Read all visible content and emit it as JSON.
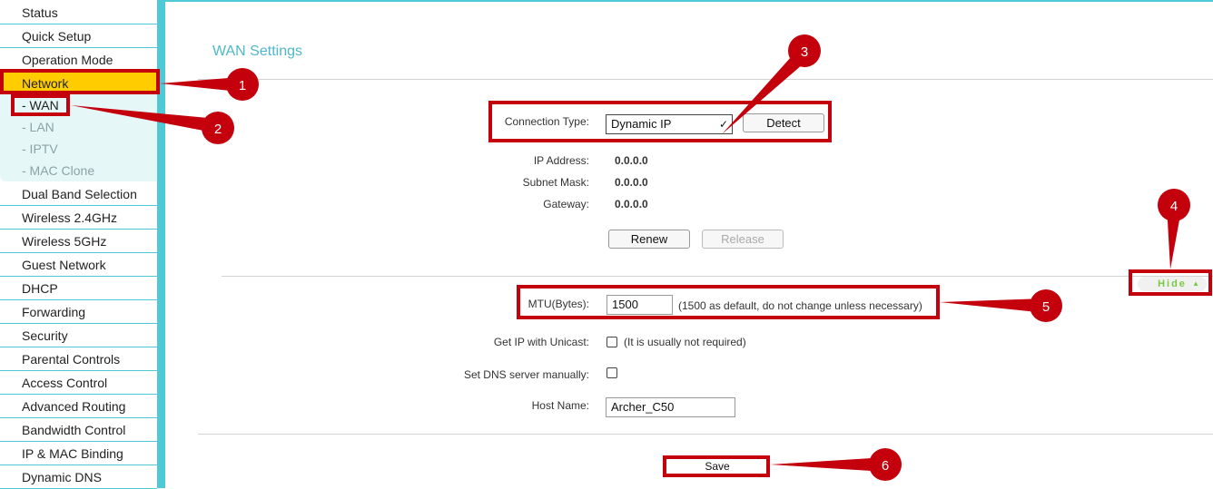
{
  "sidebar": {
    "items_top": [
      "Status",
      "Quick Setup",
      "Operation Mode",
      "Network"
    ],
    "submenu": [
      "- WAN",
      "- LAN",
      "- IPTV",
      "- MAC Clone"
    ],
    "items_bottom": [
      "Dual Band Selection",
      "Wireless 2.4GHz",
      "Wireless 5GHz",
      "Guest Network",
      "DHCP",
      "Forwarding",
      "Security",
      "Parental Controls",
      "Access Control",
      "Advanced Routing",
      "Bandwidth Control",
      "IP & MAC Binding",
      "Dynamic DNS"
    ]
  },
  "main": {
    "title": "WAN Settings",
    "connection_type_label": "Connection Type:",
    "connection_type_value": "Dynamic IP",
    "detect_label": "Detect",
    "ip_address_label": "IP Address:",
    "ip_address_value": "0.0.0.0",
    "subnet_mask_label": "Subnet Mask:",
    "subnet_mask_value": "0.0.0.0",
    "gateway_label": "Gateway:",
    "gateway_value": "0.0.0.0",
    "renew_label": "Renew",
    "release_label": "Release",
    "hide_label": "Hide",
    "mtu_label": "MTU(Bytes):",
    "mtu_value": "1500",
    "mtu_note": "(1500 as default,  do not change unless necessary)",
    "unicast_label": "Get IP with Unicast:",
    "unicast_note": "(It is usually not required)",
    "dns_label": "Set DNS server manually:",
    "host_name_label": "Host Name:",
    "host_name_value": "Archer_C50",
    "save_label": "Save"
  },
  "annotations": {
    "color": "#c4000d",
    "badges": [
      "1",
      "2",
      "3",
      "4",
      "5",
      "6"
    ]
  },
  "colors": {
    "accent": "#4fc9d6",
    "active_menu": "#ffcc00",
    "title": "#4fb8c8"
  }
}
